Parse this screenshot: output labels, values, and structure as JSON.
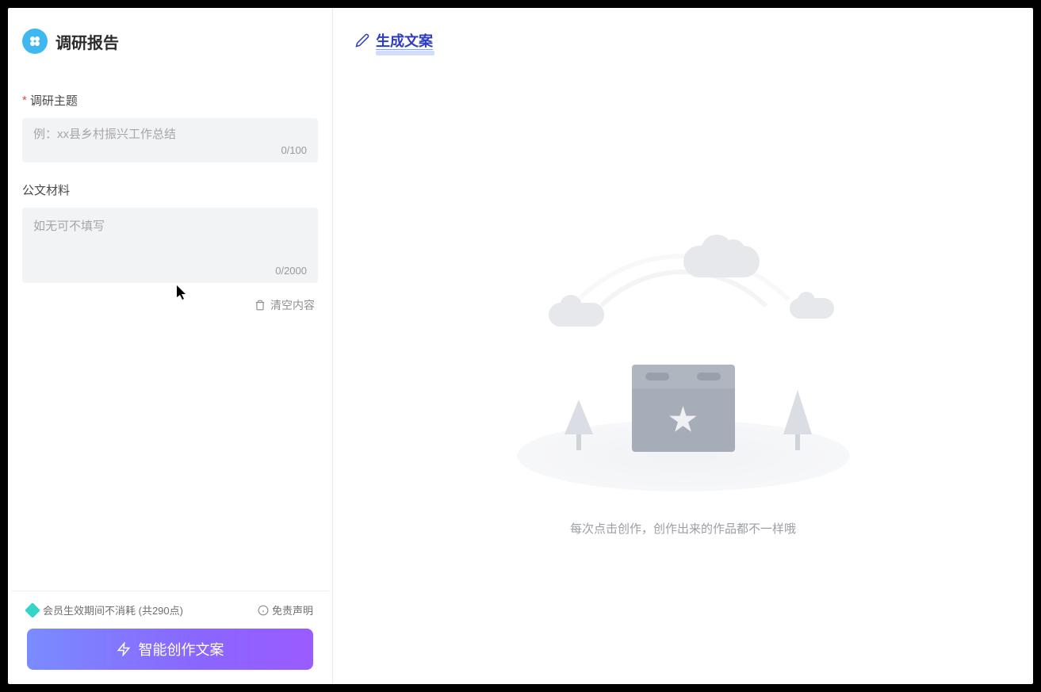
{
  "app": {
    "title": "调研报告"
  },
  "form": {
    "topic": {
      "label": "调研主题",
      "required": true,
      "placeholder": "例：xx县乡村振兴工作总结",
      "value": "",
      "counter": "0/100"
    },
    "material": {
      "label": "公文材料",
      "required": false,
      "placeholder": "如无可不填写",
      "value": "",
      "counter": "0/2000"
    },
    "clear_label": "清空内容"
  },
  "footer": {
    "credit_text": "会员生效期间不消耗 (共290点)",
    "disclaimer_label": "免责声明",
    "generate_label": "智能创作文案"
  },
  "main": {
    "generate_tab_label": "生成文案",
    "empty_hint": "每次点击创作，创作出来的作品都不一样哦"
  }
}
